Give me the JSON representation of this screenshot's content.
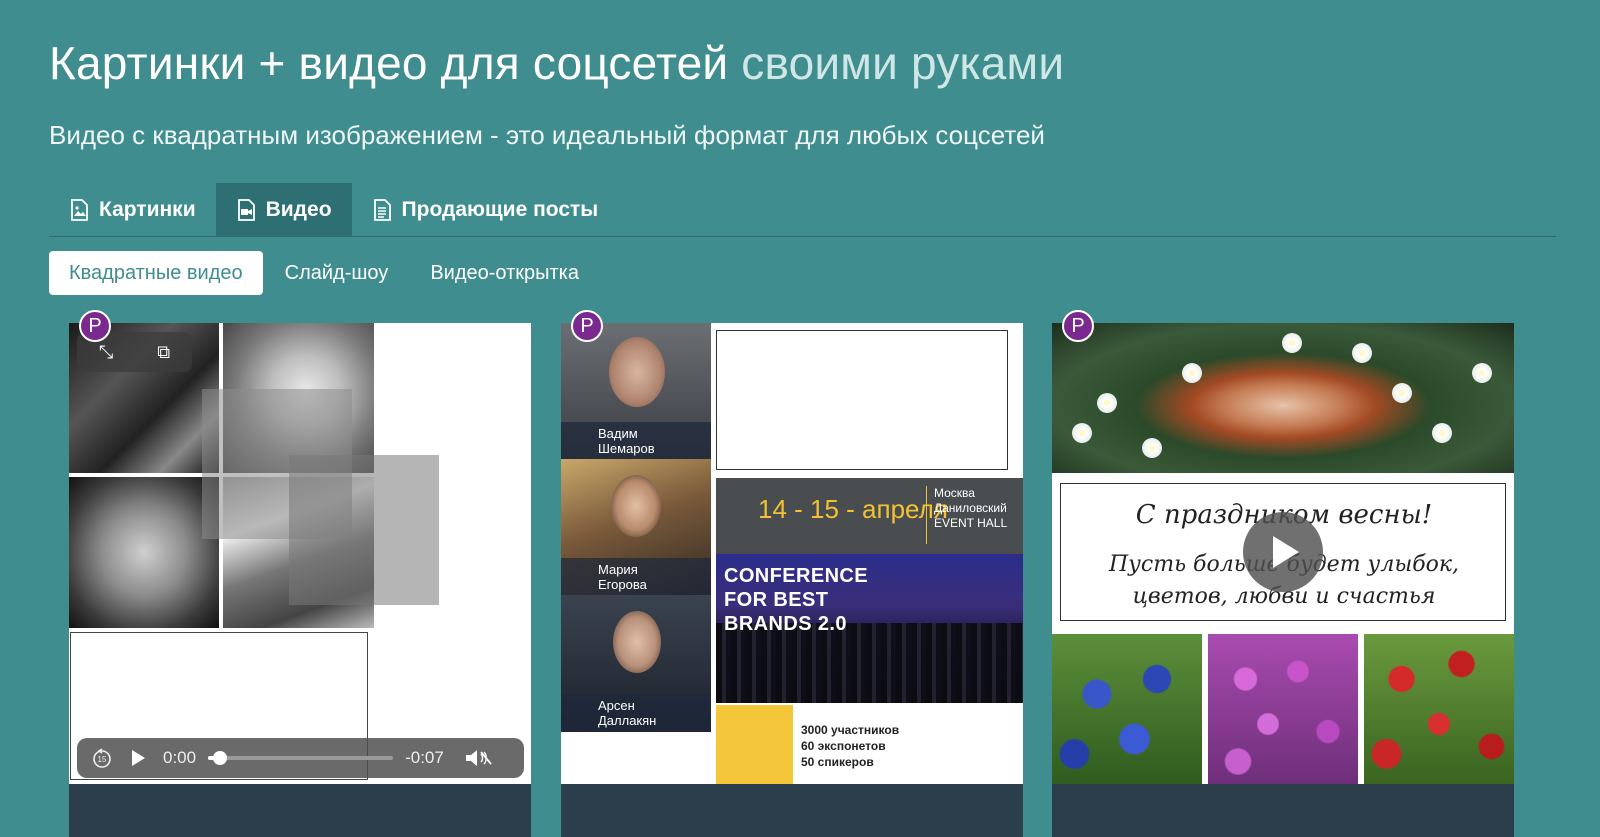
{
  "header": {
    "title_main": "Картинки + видео для соцсетей",
    "title_accent": "своими руками",
    "subtitle": "Видео с квадратным изображением - это идеальный формат для любых соцсетей"
  },
  "tabs": [
    {
      "label": "Картинки",
      "icon": "image-file-icon",
      "active": false
    },
    {
      "label": "Видео",
      "icon": "video-file-icon",
      "active": true
    },
    {
      "label": "Продающие посты",
      "icon": "document-icon",
      "active": false
    }
  ],
  "subtabs": [
    {
      "label": "Квадратные видео",
      "active": true
    },
    {
      "label": "Слайд-шоу",
      "active": false
    },
    {
      "label": "Видео-открытка",
      "active": false
    }
  ],
  "cards": {
    "badge_label": "P",
    "player": {
      "current_time": "0:00",
      "remaining_time": "-0:07",
      "progress": 0.05,
      "skip_back_label": "15"
    },
    "conference": {
      "speakers": [
        {
          "first": "Вадим",
          "last": "Шемаров"
        },
        {
          "first": "Мария",
          "last": "Егорова"
        },
        {
          "first": "Арсен",
          "last": "Даллакян"
        }
      ],
      "date": "14 - 15 - апреля",
      "location_line1": "Москва",
      "location_line2": "Даниловский",
      "location_line3": "EVENT HALL",
      "conf_line1": "CONFERENCE",
      "conf_line2": "FOR BEST",
      "conf_line3": "BRANDS 2.0",
      "stat1": "3000 участников",
      "stat2": "60 экспонетов",
      "stat3": "50 спикеров"
    },
    "greeting": {
      "line1": "С праздником весны!",
      "line2": "Пусть больше будет улыбок,",
      "line3": "цветов, любви и счастья"
    }
  },
  "colors": {
    "background": "#3f8d8f",
    "active_tab": "#2e6f73",
    "badge": "#7a2a8e",
    "card_footer": "#2c3e4c",
    "date_yellow": "#f2c233"
  }
}
